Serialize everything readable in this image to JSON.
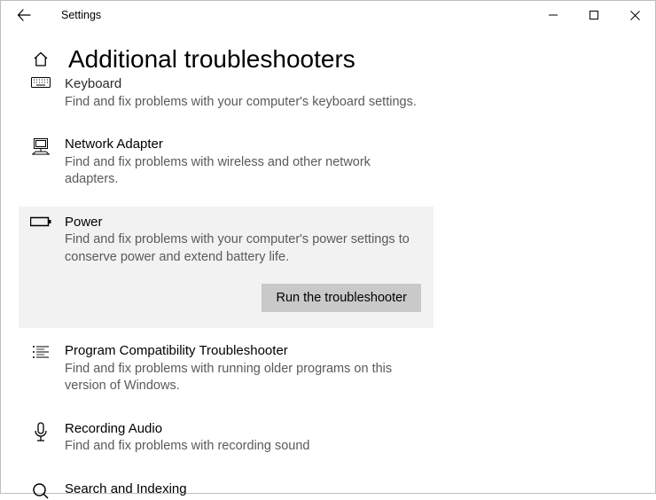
{
  "window": {
    "title": "Settings"
  },
  "page": {
    "title": "Additional troubleshooters"
  },
  "items": {
    "keyboard": {
      "title": "Keyboard",
      "desc": "Find and fix problems with your computer's keyboard settings."
    },
    "network": {
      "title": "Network Adapter",
      "desc": "Find and fix problems with wireless and other network adapters."
    },
    "power": {
      "title": "Power",
      "desc": "Find and fix problems with your computer's power settings to conserve power and extend battery life.",
      "run_label": "Run the troubleshooter"
    },
    "compat": {
      "title": "Program Compatibility Troubleshooter",
      "desc": "Find and fix problems with running older programs on this version of Windows."
    },
    "recording": {
      "title": "Recording Audio",
      "desc": "Find and fix problems with recording sound"
    },
    "search": {
      "title": "Search and Indexing"
    }
  }
}
